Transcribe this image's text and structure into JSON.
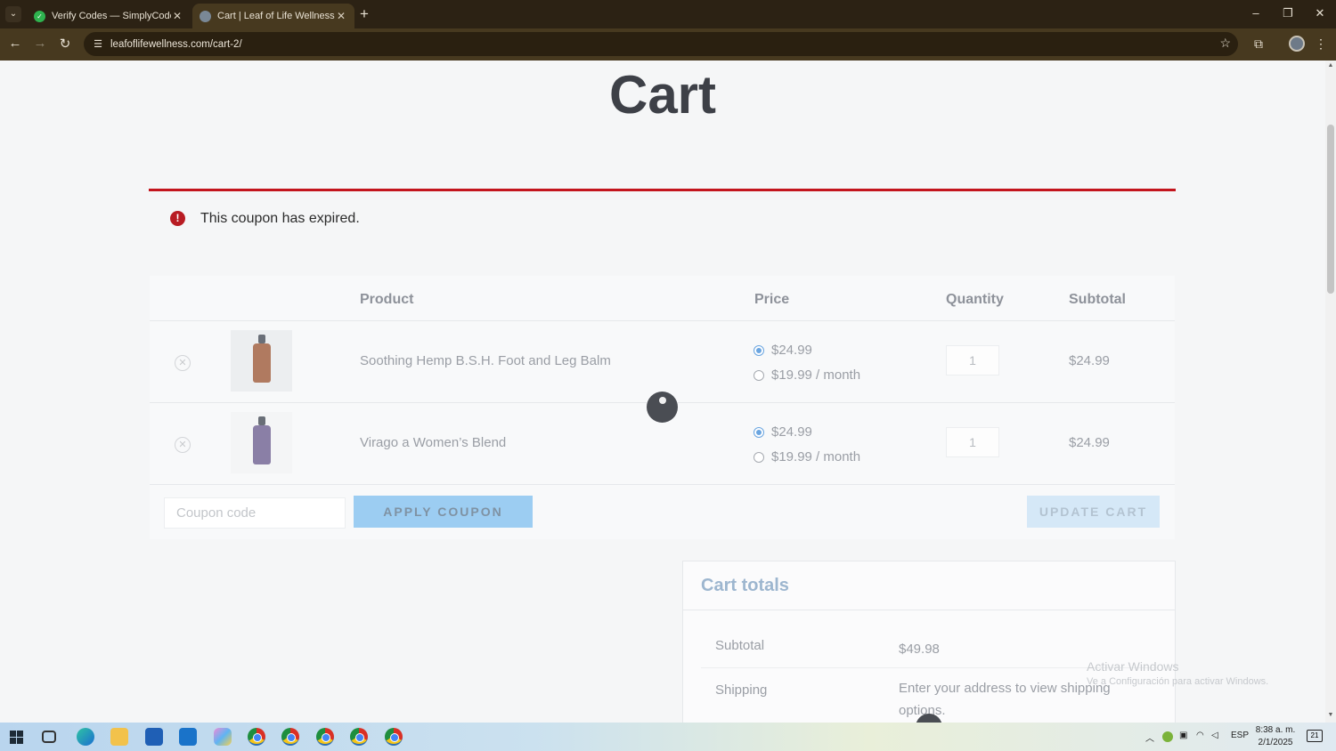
{
  "browser": {
    "tabs": [
      {
        "title": "Verify Codes — SimplyCodes",
        "active": false
      },
      {
        "title": "Cart | Leaf of Life Wellness",
        "active": true
      }
    ],
    "url": "leafoflifewellness.com/cart-2/"
  },
  "page": {
    "title": "Cart",
    "notice": "This coupon has expired.",
    "table_headers": {
      "product": "Product",
      "price": "Price",
      "quantity": "Quantity",
      "subtotal": "Subtotal"
    },
    "items": [
      {
        "name": "Soothing Hemp B.S.H. Foot and Leg Balm",
        "price_one_time": "$24.99",
        "price_subscription": "$19.99 / month",
        "quantity": "1",
        "subtotal": "$24.99",
        "bottle_color": "#b07a60"
      },
      {
        "name": "Virago a Women’s Blend",
        "price_one_time": "$24.99",
        "price_subscription": "$19.99 / month",
        "quantity": "1",
        "subtotal": "$24.99",
        "bottle_color": "#8a7fa6"
      }
    ],
    "coupon_placeholder": "Coupon code",
    "apply_coupon": "APPLY COUPON",
    "update_cart": "UPDATE CART",
    "cart_totals": {
      "title": "Cart totals",
      "subtotal_label": "Subtotal",
      "subtotal_value": "$49.98",
      "shipping_label": "Shipping",
      "shipping_value": "Enter your address to view shipping options."
    }
  },
  "watermark": {
    "line1": "Activar Windows",
    "line2": "Ve a Configuración para activar Windows."
  },
  "taskbar": {
    "language": "ESP",
    "time": "8:38 a. m.",
    "date": "2/1/2025",
    "notification_count": "21"
  },
  "colors": {
    "error_red": "#c3151d",
    "apply_blue": "#9ccdf2",
    "chrome_bg": "#47391f"
  }
}
